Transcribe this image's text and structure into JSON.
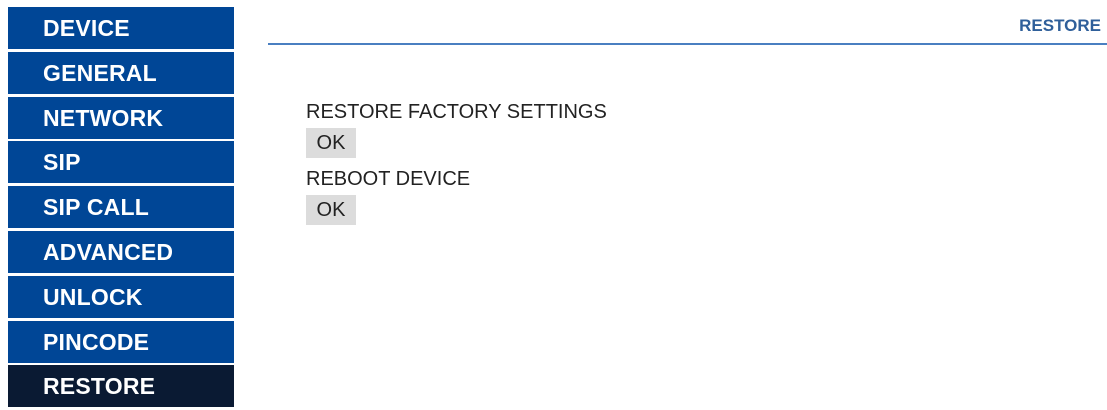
{
  "sidebar": {
    "items": [
      {
        "label": "DEVICE"
      },
      {
        "label": "GENERAL"
      },
      {
        "label": "NETWORK"
      },
      {
        "label": "SIP"
      },
      {
        "label": "SIP CALL"
      },
      {
        "label": "ADVANCED"
      },
      {
        "label": "UNLOCK"
      },
      {
        "label": "PINCODE"
      },
      {
        "label": "RESTORE",
        "active": true
      }
    ]
  },
  "header": {
    "title": "RESTORE"
  },
  "main": {
    "restore_factory": {
      "label": "RESTORE FACTORY SETTINGS",
      "button_label": "OK"
    },
    "reboot": {
      "label": "REBOOT DEVICE",
      "button_label": "OK"
    }
  },
  "colors": {
    "nav_background": "#004696",
    "nav_active_background": "#0a1a33",
    "header_title": "#2f5f9a",
    "header_rule": "#4a7fc1",
    "button_background": "#dcdcdc"
  }
}
